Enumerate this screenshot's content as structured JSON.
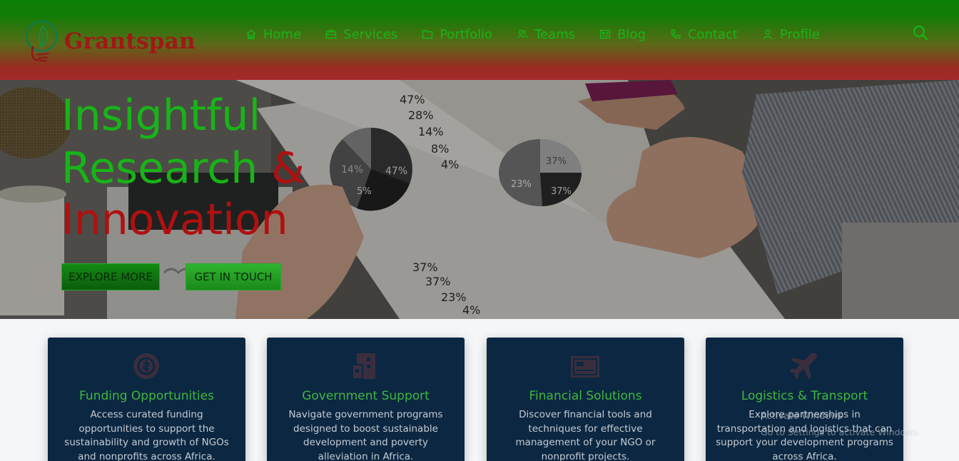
{
  "brand": {
    "name": "Grantspan"
  },
  "nav": {
    "items": [
      {
        "label": "Home",
        "icon": "home-icon"
      },
      {
        "label": "Services",
        "icon": "briefcase-icon"
      },
      {
        "label": "Portfolio",
        "icon": "folder-icon"
      },
      {
        "label": "Teams",
        "icon": "users-icon"
      },
      {
        "label": "Blog",
        "icon": "newspaper-icon"
      },
      {
        "label": "Contact",
        "icon": "phone-icon"
      },
      {
        "label": "Profile",
        "icon": "user-icon"
      }
    ],
    "search_icon": "search-icon"
  },
  "hero": {
    "line1": "Insightful",
    "line2_a": "Research",
    "line2_b": "&",
    "line3": "Innovation",
    "explore_label": "EXPLORE MORE",
    "touch_label": "GET IN TOUCH",
    "photo_labels": [
      "47%",
      "28%",
      "14%",
      "8%",
      "4%",
      "14%",
      "47%",
      "5%",
      "37%",
      "23%",
      "37%",
      "37%",
      "37%",
      "23%",
      "4%"
    ]
  },
  "cards": [
    {
      "icon": "globe-money-icon",
      "title": "Funding Opportunities",
      "description": "Access curated funding opportunities to support the sustainability and growth of NGOs and nonprofits across Africa."
    },
    {
      "icon": "building-icon",
      "title": "Government Support",
      "description": "Navigate government programs designed to boost sustainable development and poverty alleviation in Africa."
    },
    {
      "icon": "money-bill-icon",
      "title": "Financial Solutions",
      "description": "Discover financial tools and techniques for effective management of your NGO or nonprofit projects."
    },
    {
      "icon": "plane-icon",
      "title": "Logistics & Transport",
      "description": "Explore partnerships in transportation and logistics that can support your development programs across Africa."
    }
  ],
  "watermark": {
    "line1": "Activate Windows",
    "line2": "Go to Settings to activate Windows."
  },
  "colors": {
    "header_top": "#0b7f06",
    "header_bottom": "#a52a2a",
    "accent_green": "#18b417",
    "accent_red": "#b01010",
    "card_bg": "#0c2742"
  }
}
